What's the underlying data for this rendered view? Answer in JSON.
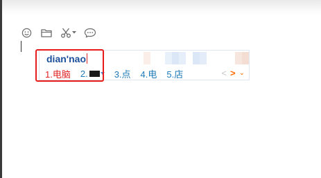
{
  "toolbar": {
    "icons": [
      "smiley-icon",
      "folder-icon",
      "scissors-icon",
      "chat-bubble-icon"
    ]
  },
  "ime": {
    "input": "dian'nao",
    "candidates": [
      {
        "label": "1.电脑",
        "selected": true
      },
      {
        "label": "2.",
        "selected": false
      },
      {
        "label": "3.点",
        "selected": false
      },
      {
        "label": "4.电",
        "selected": false
      },
      {
        "label": "5.店",
        "selected": false
      }
    ],
    "pager": {
      "prev": "<",
      "next": ">",
      "more": "⌄"
    }
  },
  "colors": {
    "selected_candidate": "#e02424",
    "candidate": "#1e7ab8",
    "input_text": "#1b4f9a",
    "annotation_box": "#e81b1b",
    "pager_active": "#ff6a00"
  }
}
